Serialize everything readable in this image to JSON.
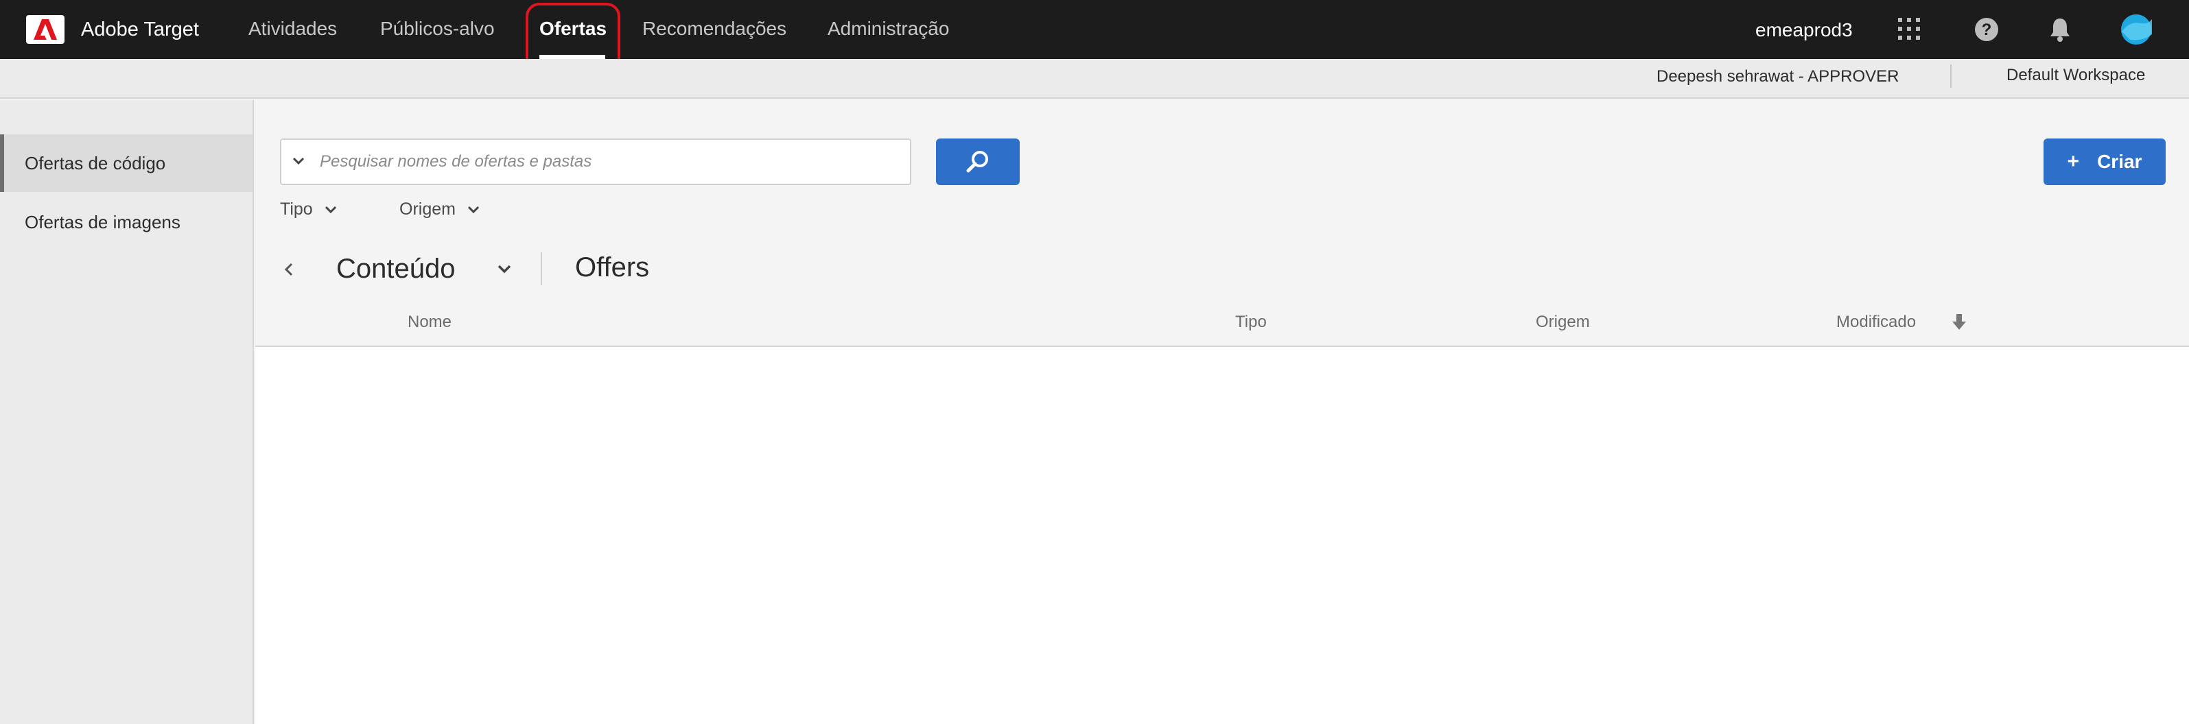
{
  "app": {
    "name": "Adobe Target"
  },
  "nav": {
    "items": [
      {
        "label": "Atividades"
      },
      {
        "label": "Públicos-alvo"
      },
      {
        "label": "Ofertas"
      },
      {
        "label": "Recomendações"
      },
      {
        "label": "Administração"
      }
    ],
    "active": "Ofertas"
  },
  "header": {
    "org": "emeaprod3",
    "icons": [
      "apps-grid-icon",
      "help-icon",
      "bell-icon",
      "avatar"
    ],
    "user": "Deepesh sehrawat - APPROVER",
    "workspace": "Default Workspace"
  },
  "sidebar": {
    "items": [
      {
        "label": "Ofertas de código",
        "active": true
      },
      {
        "label": "Ofertas de imagens",
        "active": false
      }
    ]
  },
  "search": {
    "placeholder": "Pesquisar nomes de ofertas e pastas"
  },
  "actions": {
    "create_label": "Criar"
  },
  "filters": [
    {
      "label": "Tipo"
    },
    {
      "label": "Origem"
    }
  ],
  "breadcrumb": {
    "parent": "Conteúdo",
    "current": "Offers"
  },
  "table": {
    "columns": [
      "Nome",
      "Tipo",
      "Origem",
      "Modificado"
    ],
    "rows": []
  },
  "colors": {
    "accent": "#2d6fc9",
    "topbar": "#1c1c1c",
    "highlight": "#e0161e",
    "avatar": "#1fa8e0"
  }
}
